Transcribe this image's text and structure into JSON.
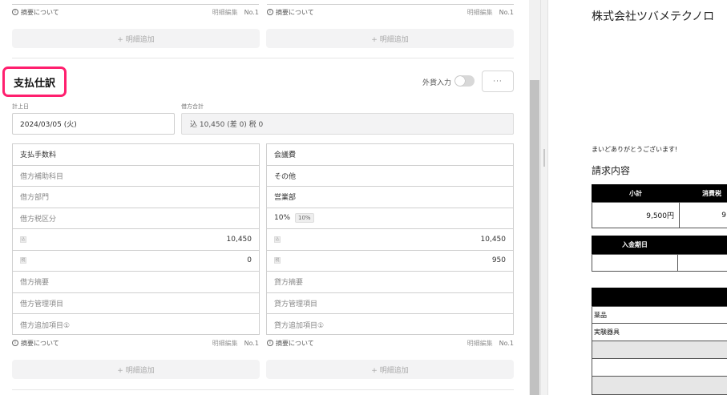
{
  "line_footer": {
    "summary_link": "摘要について",
    "edit_label": "明細編集",
    "number": "No.1",
    "info_icon": "ⓘ"
  },
  "add_line_label": "+ 明細追加",
  "section": {
    "title": "支払仕訳",
    "fx_label": "外貨入力",
    "more_label": "···"
  },
  "fields": {
    "date_label": "計上日",
    "date_value": "2024/03/05 (火)",
    "total_label": "借方合計",
    "total_value": "込 10,450 (差 0)  税 0"
  },
  "debit": {
    "account": "支払手数料",
    "sub_account": "借方補助科目",
    "department": "借方部門",
    "tax_type": "借方税区分",
    "amount_incl_icon": "込",
    "amount_incl": "10,450",
    "tax_icon": "税",
    "tax_amount": "0",
    "memo": "借方摘要",
    "mgmt_item": "借方管理項目",
    "extra_item": "借方追加項目①"
  },
  "credit": {
    "account": "会議費",
    "sub_account": "その他",
    "department": "営業部",
    "tax_type": "10%",
    "tax_badge": "10%",
    "amount_incl_icon": "込",
    "amount_incl": "10,450",
    "tax_icon": "税",
    "tax_amount": "950",
    "memo": "貸方摘要",
    "mgmt_item": "貸方管理項目",
    "extra_item": "貸方追加項目①"
  },
  "invoice": {
    "company": "株式会社ツバメテクノロ",
    "thanks": "まいどありがとうございます!",
    "content_title": "請求内容",
    "subtotal_label": "小計",
    "tax_label": "消費税",
    "subtotal_value": "9,500円",
    "tax_value_partial": "9",
    "payment_date_label": "入金期日",
    "item1": "薬品",
    "item2": "実験器具"
  },
  "colors": {
    "highlight": "#ff1f6e"
  }
}
